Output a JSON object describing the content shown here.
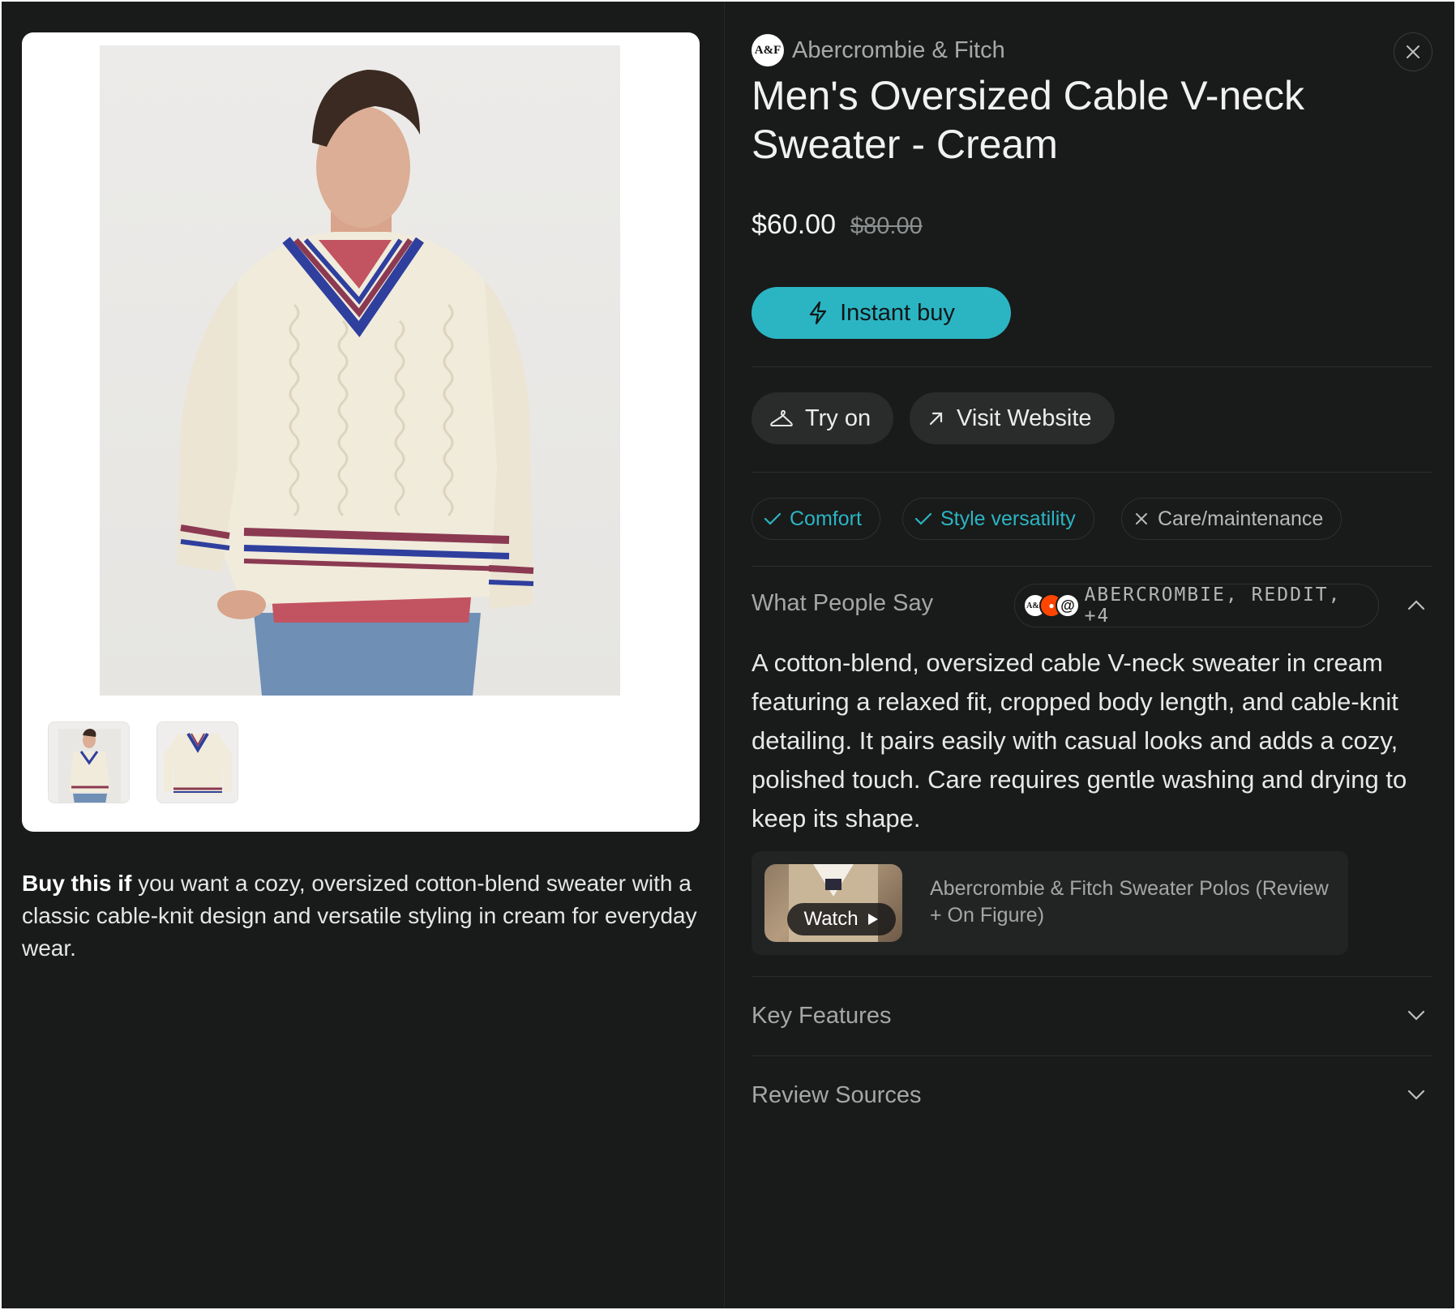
{
  "product": {
    "brand": "Abercrombie & Fitch",
    "brand_logo_text": "A&F",
    "title": "Men's Oversized Cable V-neck Sweater - Cream",
    "price": "$60.00",
    "original_price": "$80.00"
  },
  "actions": {
    "instant_buy": "Instant buy",
    "try_on": "Try on",
    "visit_website": "Visit Website"
  },
  "tags": [
    {
      "label": "Comfort",
      "type": "positive"
    },
    {
      "label": "Style versatility",
      "type": "positive"
    },
    {
      "label": "Care/maintenance",
      "type": "negative"
    }
  ],
  "buy_this": {
    "lead": "Buy this if",
    "text": " you want a cozy, oversized cotton-blend sweater with a classic cable-knit design and versatile styling in cream for everyday wear."
  },
  "what_people_say": {
    "label": "What People Say",
    "sources": "ABERCROMBIE, REDDIT, +4",
    "summary": "A cotton-blend, oversized cable V-neck sweater in cream featuring a relaxed fit, cropped body length, and cable-knit detailing. It pairs easily with casual looks and adds a cozy, polished touch. Care requires gentle washing and drying to keep its shape."
  },
  "video": {
    "watch_label": "Watch",
    "title": "Abercrombie & Fitch Sweater Polos (Review + On Figure)"
  },
  "sections": {
    "key_features": "Key Features",
    "review_sources": "Review Sources"
  },
  "colors": {
    "accent": "#2bb5c3",
    "background": "#191a1a",
    "sweater": "#f1ebdc",
    "stripe_navy": "#2f3f9e",
    "stripe_maroon": "#8b3a52"
  }
}
